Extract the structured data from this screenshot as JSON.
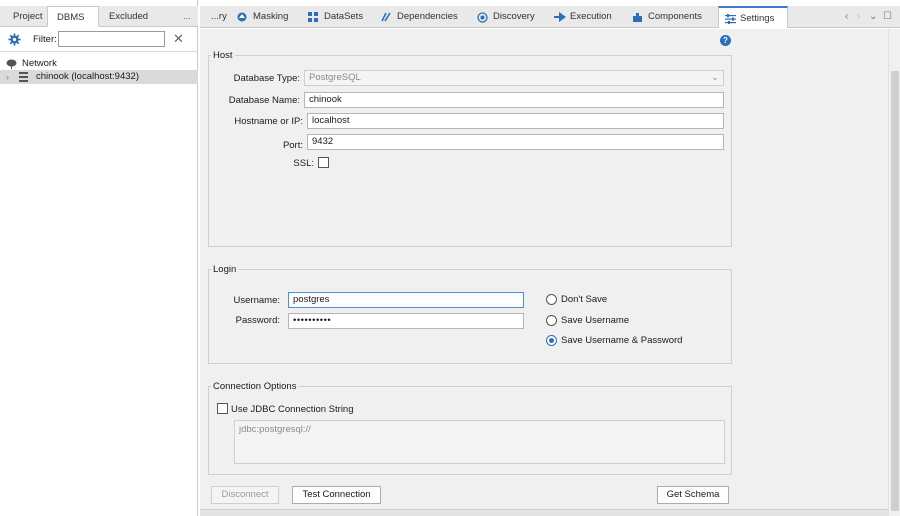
{
  "left_panel": {
    "tabs": [
      "Project",
      "DBMS",
      "Excluded",
      "..."
    ],
    "active_tab": "DBMS",
    "filter": {
      "label": "Filter:",
      "value": "",
      "placeholder": ""
    },
    "tree": [
      {
        "label": "Network",
        "icon": "network-icon"
      },
      {
        "label": "chinook (localhost:9432)",
        "icon": "database-icon",
        "selected": true
      }
    ]
  },
  "tabs": [
    {
      "label": "...ry",
      "icon": ""
    },
    {
      "label": "Masking",
      "icon": "masking-icon"
    },
    {
      "label": "DataSets",
      "icon": "datasets-icon"
    },
    {
      "label": "Dependencies",
      "icon": "dependencies-icon"
    },
    {
      "label": "Discovery",
      "icon": "discovery-icon"
    },
    {
      "label": "Execution",
      "icon": "execution-icon"
    },
    {
      "label": "Components",
      "icon": "components-icon"
    },
    {
      "label": "Settings",
      "icon": "settings-icon"
    }
  ],
  "active_tab": "Settings",
  "tab_controls": [
    "‹",
    "›",
    "⌄",
    "☐"
  ],
  "host": {
    "title": "Host",
    "db_type_label": "Database Type:",
    "db_type_value": "PostgreSQL",
    "db_name_label": "Database Name:",
    "db_name_value": "chinook",
    "hostname_label": "Hostname or IP:",
    "hostname_value": "localhost",
    "port_label": "Port:",
    "port_value": "9432",
    "ssl_label": "SSL:",
    "ssl_checked": false
  },
  "login": {
    "title": "Login",
    "username_label": "Username:",
    "username_value": "postgres",
    "password_label": "Password:",
    "password_value": "••••••••••",
    "options": [
      "Don't Save",
      "Save Username",
      "Save Username & Password"
    ],
    "selected_option": "Save Username & Password"
  },
  "connection": {
    "title": "Connection Options",
    "jdbc_label": "Use JDBC Connection String",
    "jdbc_checked": false,
    "jdbc_placeholder": "jdbc:postgresql://"
  },
  "buttons": {
    "disconnect": "Disconnect",
    "test": "Test Connection",
    "schema": "Get Schema"
  },
  "colors": {
    "accent": "#2a6fb8",
    "selection": "#dadada"
  }
}
